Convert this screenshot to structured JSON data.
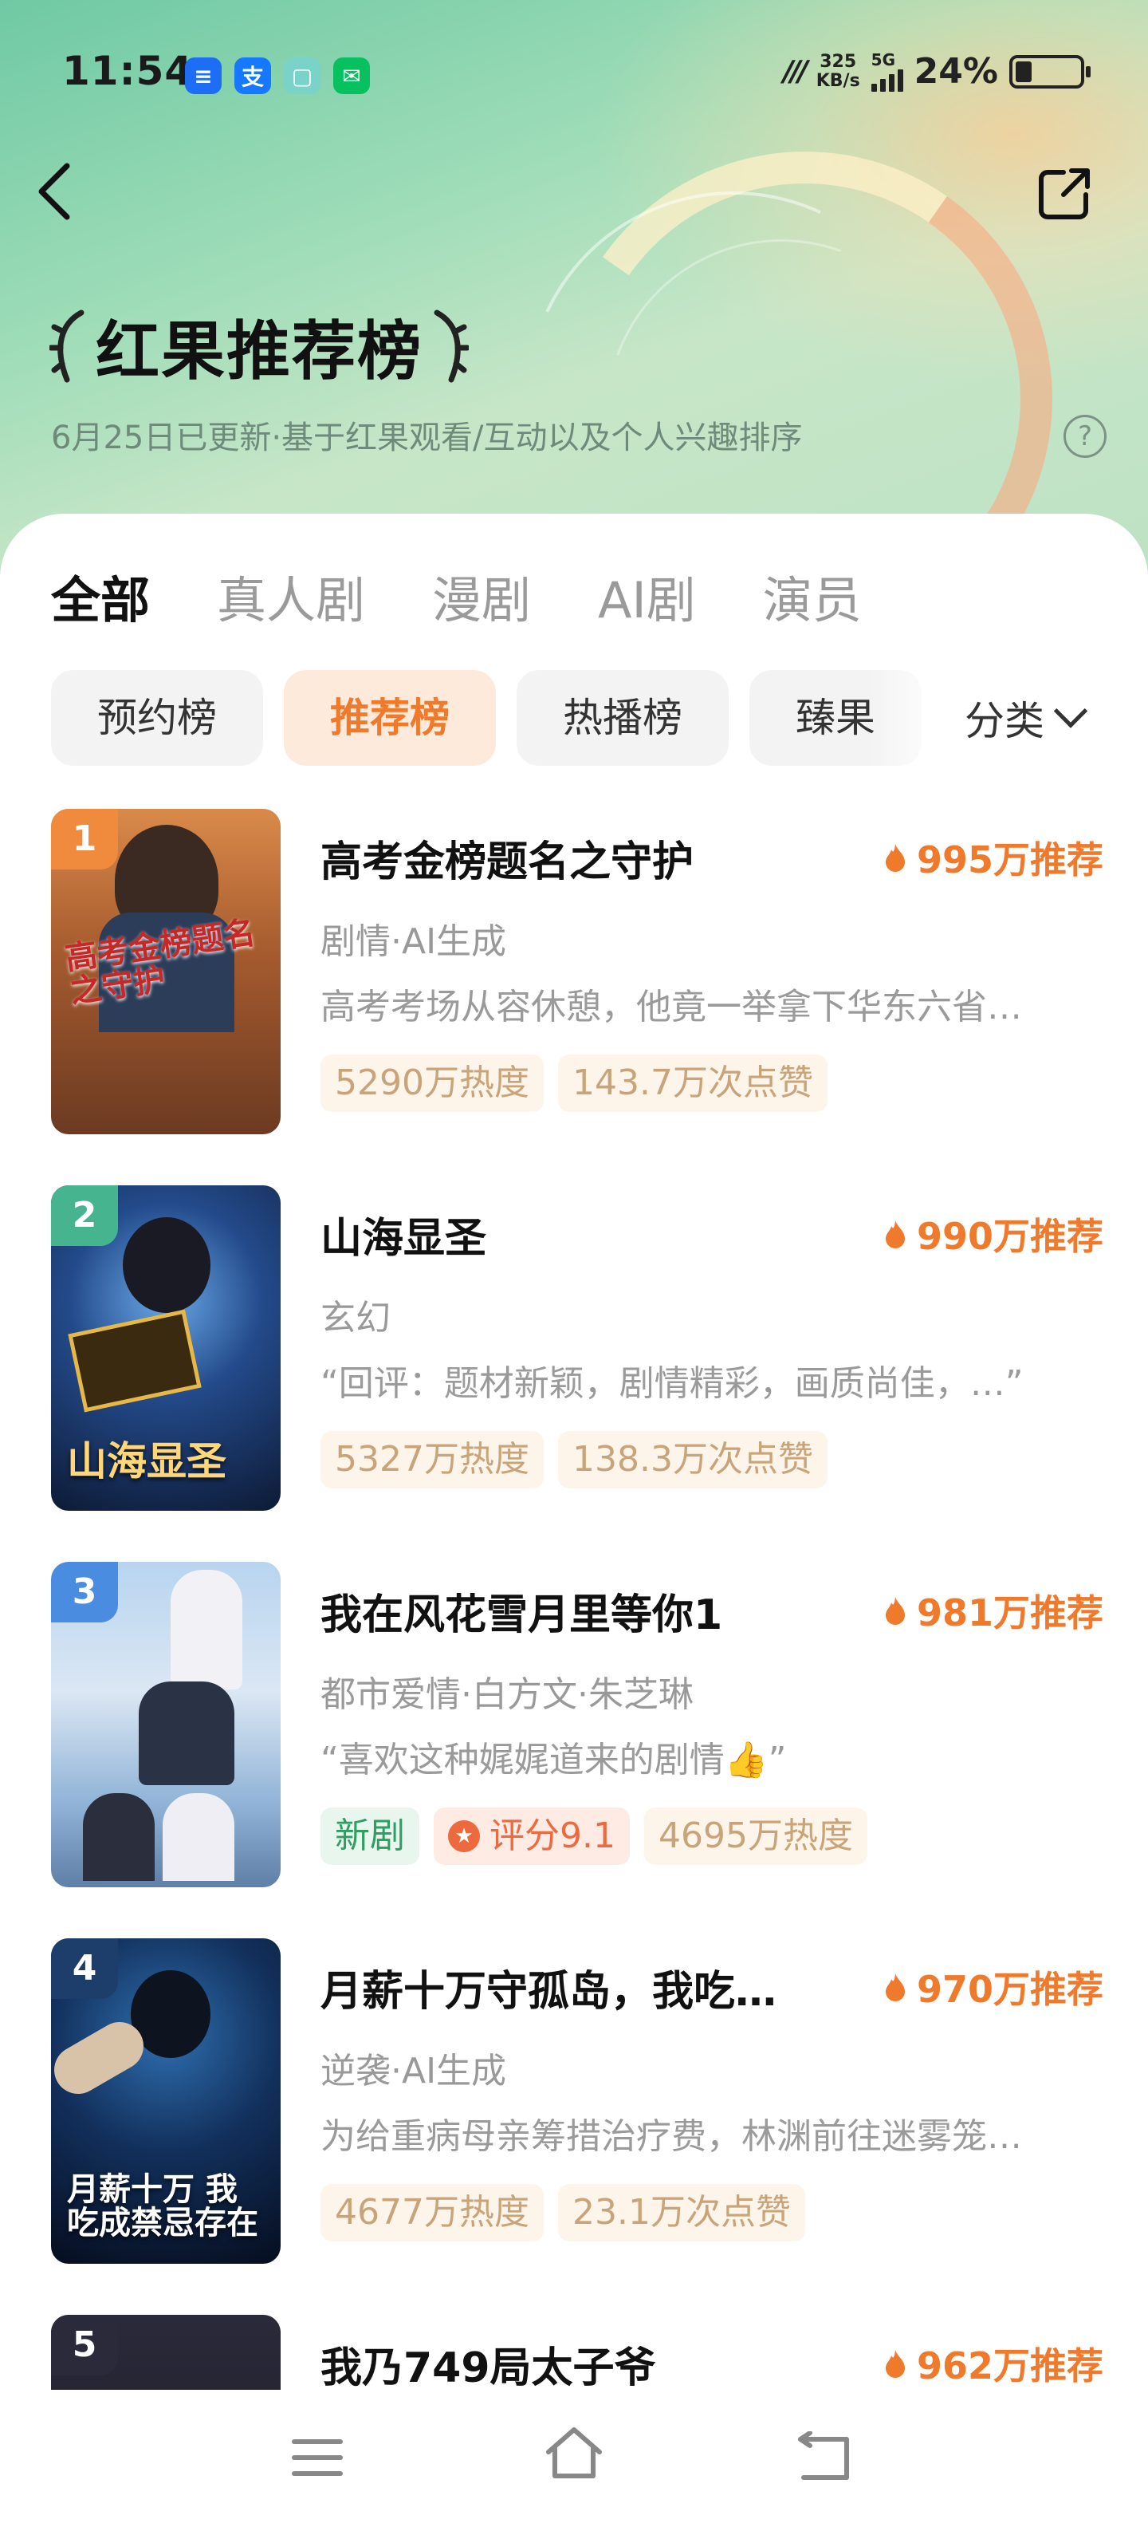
{
  "status_bar": {
    "time": "11:54",
    "net_speed_value": "325",
    "net_speed_unit": "KB/s",
    "signal_label": "5G",
    "battery_percent": "24%",
    "app_icons": [
      "message-app-icon",
      "alipay-icon",
      "gallery-app-icon",
      "wechat-icon"
    ]
  },
  "header": {
    "title": "红果推荐榜",
    "subtitle": "6月25日已更新·基于红果观看/互动以及个人兴趣排序",
    "help_glyph": "?"
  },
  "tabs": [
    {
      "label": "全部",
      "active": true
    },
    {
      "label": "真人剧",
      "active": false
    },
    {
      "label": "漫剧",
      "active": false
    },
    {
      "label": "AI剧",
      "active": false
    },
    {
      "label": "演员",
      "active": false
    }
  ],
  "chips": [
    {
      "label": "预约榜",
      "active": false
    },
    {
      "label": "推荐榜",
      "active": true
    },
    {
      "label": "热播榜",
      "active": false
    },
    {
      "label": "臻果",
      "active": false
    }
  ],
  "category_label": "分类",
  "items": [
    {
      "rank": "1",
      "rank_color": "#f08a3c",
      "title": "高考金榜题名之守护",
      "recommend": "995万推荐",
      "genre": "剧情·AI生成",
      "desc": "高考考场从容休憩，他竟一举拿下华东六省…",
      "tags": [
        "5290万热度",
        "143.7万次点赞"
      ],
      "poster_text": "高考金榜题名之守护"
    },
    {
      "rank": "2",
      "rank_color": "#46b58f",
      "title": "山海显圣",
      "recommend": "990万推荐",
      "genre": "玄幻",
      "desc": "“回评：题材新颖，剧情精彩，画质尚佳，…”",
      "tags": [
        "5327万热度",
        "138.3万次点赞"
      ],
      "poster_text": "山海显圣"
    },
    {
      "rank": "3",
      "rank_color": "#4a8de0",
      "title": "我在风花雪月里等你1",
      "recommend": "981万推荐",
      "genre": "都市爱情·白方文·朱芝琳",
      "desc": "“喜欢这种娓娓道来的剧情👍”",
      "tag_new": "新剧",
      "tag_score": "评分9.1",
      "tags": [
        "4695万热度"
      ],
      "poster_text": ""
    },
    {
      "rank": "4",
      "rank_color": "#1d3d6b",
      "title": "月薪十万守孤岛，我吃…",
      "recommend": "970万推荐",
      "genre": "逆袭·AI生成",
      "desc": "为给重病母亲筹措治疗费，林渊前往迷雾笼…",
      "tags": [
        "4677万热度",
        "23.1万次点赞"
      ],
      "poster_text": "月薪十万 我吃成禁忌存在"
    },
    {
      "rank": "5",
      "rank_color": "#2a2a3a",
      "title": "我乃749局太子爷",
      "recommend": "962万推荐"
    }
  ],
  "colors": {
    "accent_orange": "#f07a2c",
    "chip_active_bg": "#fdeadb",
    "tag_bg": "#fdf4ea",
    "tag_text": "#c9a479",
    "header_green": "#9ddcb7"
  }
}
